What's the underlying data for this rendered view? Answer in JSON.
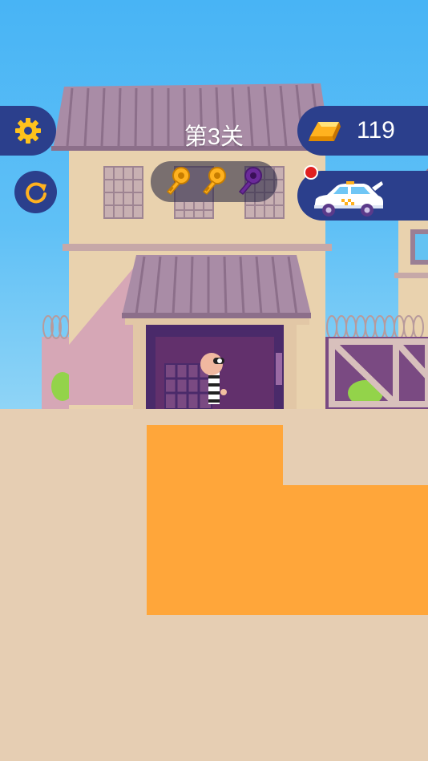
{
  "hud": {
    "level_title": "第3关",
    "gold_count": "119",
    "keys_total": 3,
    "keys_collected": 2,
    "settings_icon": "gear-icon",
    "restart_icon": "restart-icon",
    "gold_icon": "gold-bar-icon",
    "vehicle_icon": "police-car-icon",
    "notification": true
  },
  "colors": {
    "hud_pill": "#2b3f8c",
    "key_gold": "#ffb21f",
    "key_missing": "#6b2a9a",
    "sand": "#ffa63a",
    "ground": "#e6ceb3",
    "sky": "#4cb6f5",
    "notify": "#e02020"
  }
}
